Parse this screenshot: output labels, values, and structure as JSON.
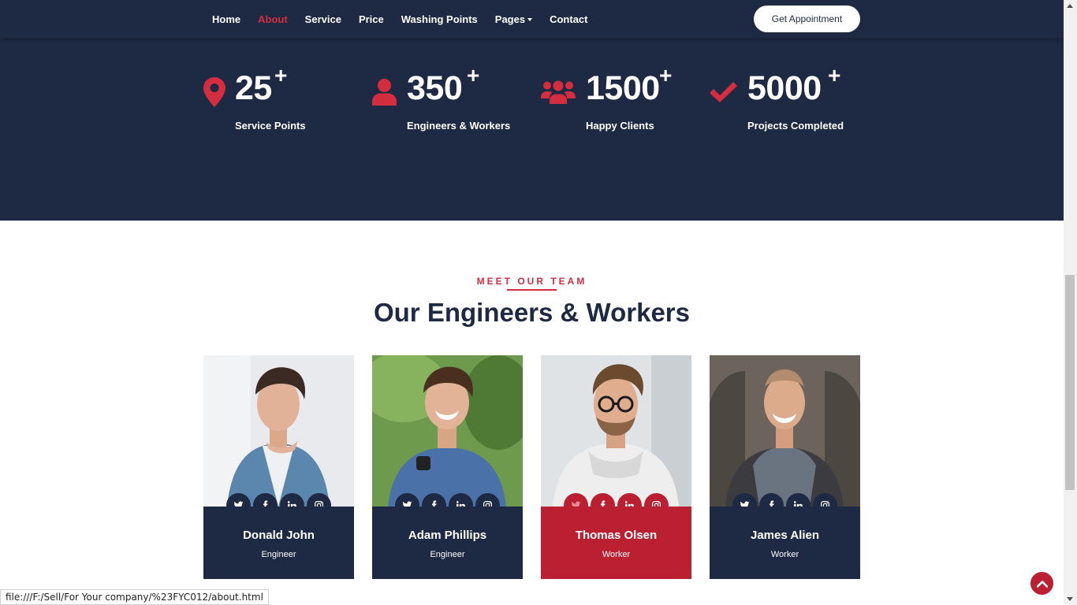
{
  "nav": {
    "items": [
      {
        "label": "Home",
        "active": false
      },
      {
        "label": "About",
        "active": true
      },
      {
        "label": "Service",
        "active": false
      },
      {
        "label": "Price",
        "active": false
      },
      {
        "label": "Washing Points",
        "active": false
      },
      {
        "label": "Pages",
        "active": false,
        "dropdown": true
      },
      {
        "label": "Contact",
        "active": false
      }
    ],
    "cta_label": "Get Appointment"
  },
  "stats": [
    {
      "icon": "map-marker-icon",
      "number": "25",
      "suffix": "+",
      "label": "Service Points"
    },
    {
      "icon": "user-icon",
      "number": "350",
      "suffix": "+",
      "label": "Engineers & Workers"
    },
    {
      "icon": "users-icon",
      "number": "1500",
      "suffix": "+",
      "label": "Happy Clients"
    },
    {
      "icon": "check-icon",
      "number": "5000",
      "suffix": "+",
      "label": "Projects Completed"
    }
  ],
  "team": {
    "eyebrow": "MEET OUR TEAM",
    "title": "Our Engineers & Workers",
    "members": [
      {
        "name": "Donald John",
        "role": "Engineer",
        "highlight": false
      },
      {
        "name": "Adam Phillips",
        "role": "Engineer",
        "highlight": false
      },
      {
        "name": "Thomas Olsen",
        "role": "Worker",
        "highlight": true
      },
      {
        "name": "James Alien",
        "role": "Worker",
        "highlight": false
      }
    ],
    "social_icons": [
      "twitter-icon",
      "facebook-icon",
      "linkedin-icon",
      "instagram-icon"
    ]
  },
  "status_bar": {
    "url": "file:///F:/Sell/For Your company/%23FYC012/about.html"
  },
  "colors": {
    "navy": "#1e2943",
    "accent": "#d42d3f",
    "highlight": "#ba1f32",
    "white": "#ffffff"
  }
}
